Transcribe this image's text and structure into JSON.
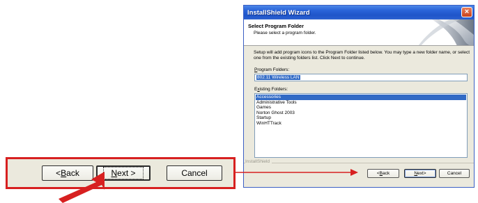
{
  "colors": {
    "callout_border": "#d72020",
    "arrow": "#d72020",
    "titlebar": "#2a63d8",
    "selection": "#316ac5",
    "dialog_bg": "#ebe9dd"
  },
  "callout": {
    "back_prefix": "< ",
    "back_letter": "B",
    "back_rest": "ack",
    "next_letter": "N",
    "next_rest": "ext",
    "next_suffix": " >",
    "cancel_label": "Cancel"
  },
  "window": {
    "title": "InstallShield Wizard",
    "close_icon": "×",
    "banner": {
      "title": "Select Program Folder",
      "subtitle": "Please select a program folder."
    },
    "description": "Setup will add program icons to the Program Folder listed below.  You may type a new folder name, or select one from the existing folders list.  Click Next to continue.",
    "program_folders": {
      "label_letter": "P",
      "label_rest": "rogram Folders:",
      "value": "802.11 Wireless LAN"
    },
    "existing_folders": {
      "label_prefix": "E",
      "label_letter": "x",
      "label_rest": "isting Folders:",
      "items": [
        "Accessories",
        "Administrative Tools",
        "Games",
        "Norton Ghost 2003",
        "Startup",
        "WinHTTrack"
      ],
      "selected_index": 0
    },
    "brand": "InstallShield",
    "buttons": {
      "back_prefix": "< ",
      "back_letter": "B",
      "back_rest": "ack",
      "next_letter": "N",
      "next_rest": "ext",
      "next_suffix": " >",
      "cancel": "Cancel"
    }
  }
}
